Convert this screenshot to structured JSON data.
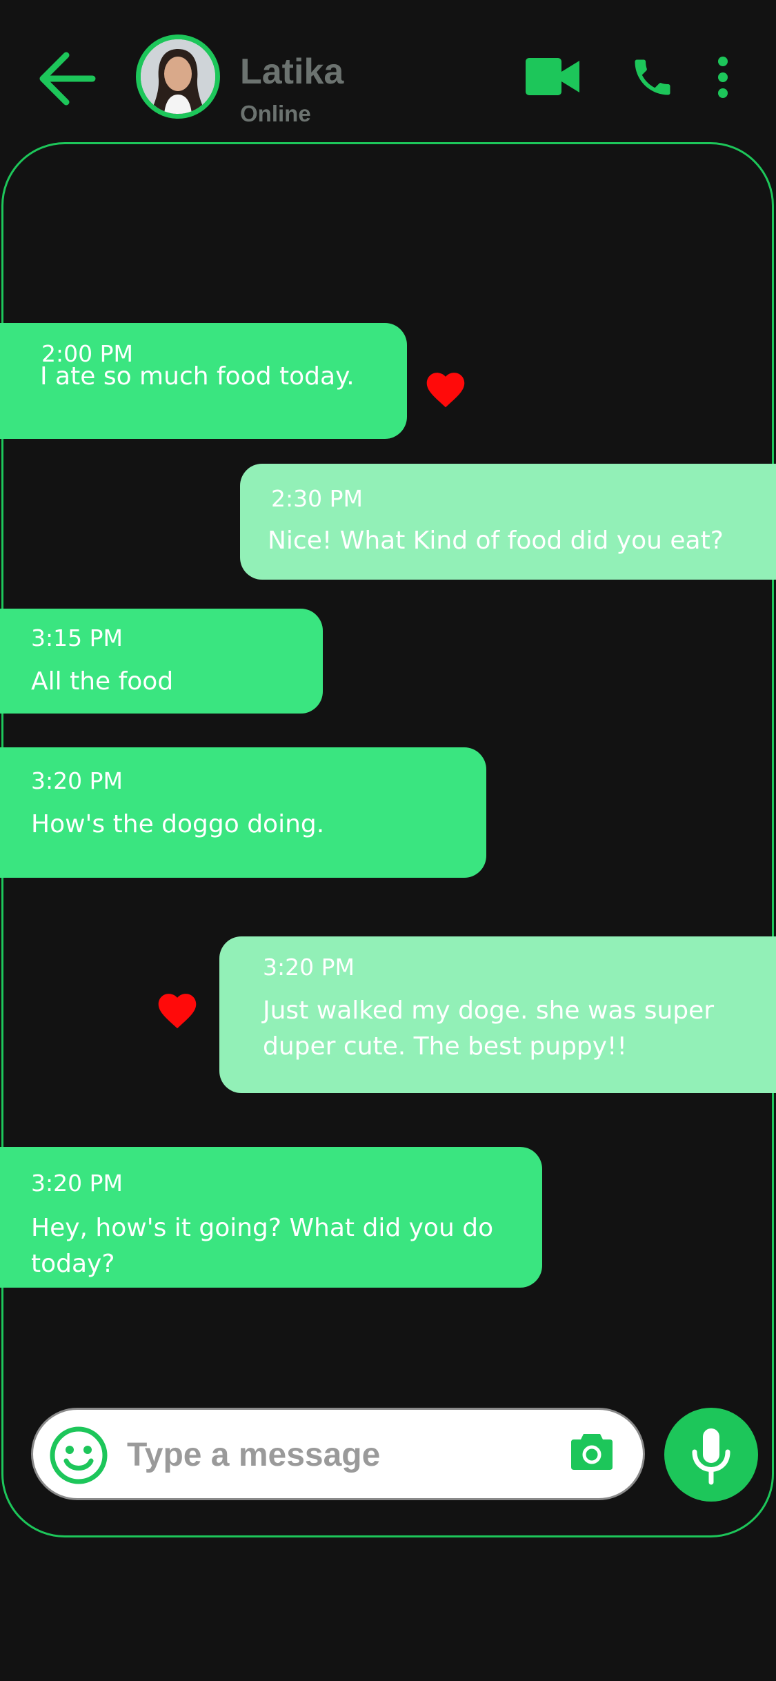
{
  "header": {
    "contact_name": "Latika",
    "contact_status": "Online"
  },
  "colors": {
    "accent": "#1dc65a",
    "incoming_bubble": "#3ae580",
    "outgoing_bubble": "#92f0b7",
    "heart": "#ff0a0a",
    "background": "#121212"
  },
  "messages": [
    {
      "direction": "incoming",
      "time": "2:00 PM",
      "text": "I ate so much food today.",
      "liked": true
    },
    {
      "direction": "outgoing",
      "time": "2:30 PM",
      "text": "Nice! What Kind of food did you eat?",
      "liked": false
    },
    {
      "direction": "incoming",
      "time": "3:15 PM",
      "text": "All the food",
      "liked": false
    },
    {
      "direction": "incoming",
      "time": "3:20 PM",
      "text": "How's the doggo doing.",
      "liked": false
    },
    {
      "direction": "outgoing",
      "time": "3:20 PM",
      "text": "Just walked my doge. she was super\nduper cute. The best puppy!!",
      "liked": true
    },
    {
      "direction": "incoming",
      "time": "3:20 PM",
      "text": "Hey, how's it going? What did you do\ntoday?",
      "liked": false
    }
  ],
  "composer": {
    "placeholder": "Type a message"
  },
  "icons": {
    "back": "arrow-left-icon",
    "video": "video-camera-icon",
    "call": "phone-icon",
    "more": "more-vertical-icon",
    "emoji": "smiley-icon",
    "camera": "camera-icon",
    "mic": "microphone-icon",
    "like": "heart-icon"
  }
}
